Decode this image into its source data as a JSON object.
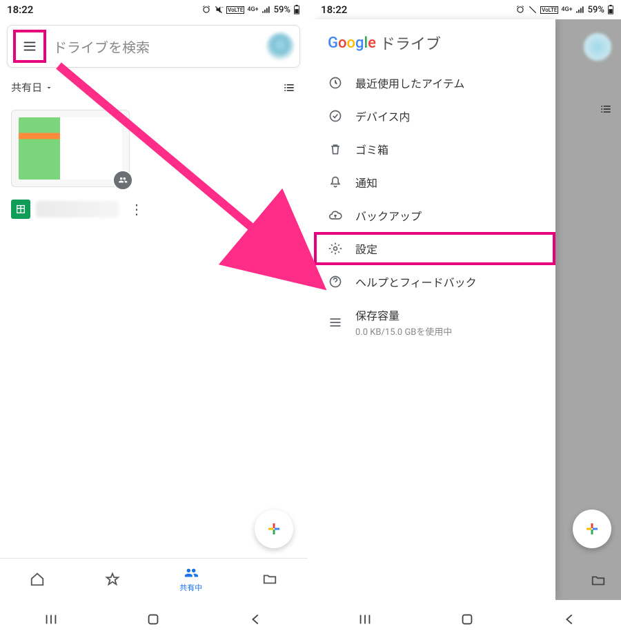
{
  "status": {
    "time": "18:22",
    "battery": "59%",
    "net": "4G+"
  },
  "search": {
    "placeholder": "ドライブを検索"
  },
  "sort": {
    "label": "共有日"
  },
  "bottomnav": {
    "shared": "共有中"
  },
  "drawer": {
    "app": "ドライブ",
    "items": {
      "recent": "最近使用したアイテム",
      "device": "デバイス内",
      "trash": "ゴミ箱",
      "notifications": "通知",
      "backup": "バックアップ",
      "settings": "設定",
      "help": "ヘルプとフィードバック",
      "storage_label": "保存容量",
      "storage_detail": "0.0 KB/15.0 GBを使用中"
    }
  }
}
